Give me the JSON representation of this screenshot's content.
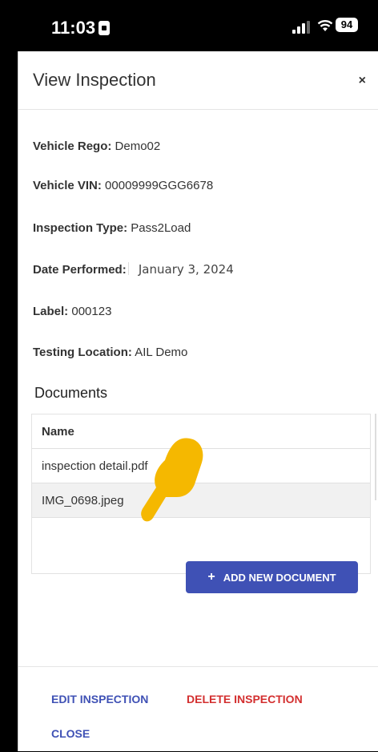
{
  "status_bar": {
    "time": "11:03",
    "battery": "94"
  },
  "dialog": {
    "title": "View Inspection",
    "close_glyph": "×"
  },
  "fields": {
    "rego_label": "Vehicle Rego:",
    "rego_value": "Demo02",
    "vin_label": "Vehicle VIN:",
    "vin_value": "00009999GGG6678",
    "type_label": "Inspection Type:",
    "type_value": "Pass2Load",
    "date_label": "Date Performed:",
    "date_value": "January 3, 2024",
    "label_label": "Label:",
    "label_value": "000123",
    "location_label": "Testing Location:",
    "location_value": "AIL Demo"
  },
  "documents": {
    "heading": "Documents",
    "column_header": "Name",
    "rows": [
      "inspection detail.pdf",
      "IMG_0698.jpeg"
    ],
    "add_button": "ADD NEW DOCUMENT",
    "add_icon": "+"
  },
  "footer": {
    "edit": "EDIT INSPECTION",
    "delete": "DELETE INSPECTION",
    "close": "CLOSE"
  },
  "icons": [
    "clock-badge-icon",
    "signal-icon",
    "wifi-icon",
    "battery-icon",
    "close-icon",
    "plus-icon",
    "pointing-hand-icon"
  ],
  "colors": {
    "primary": "#3f51b5",
    "danger": "#d32f2f",
    "hand": "#f5b800"
  }
}
